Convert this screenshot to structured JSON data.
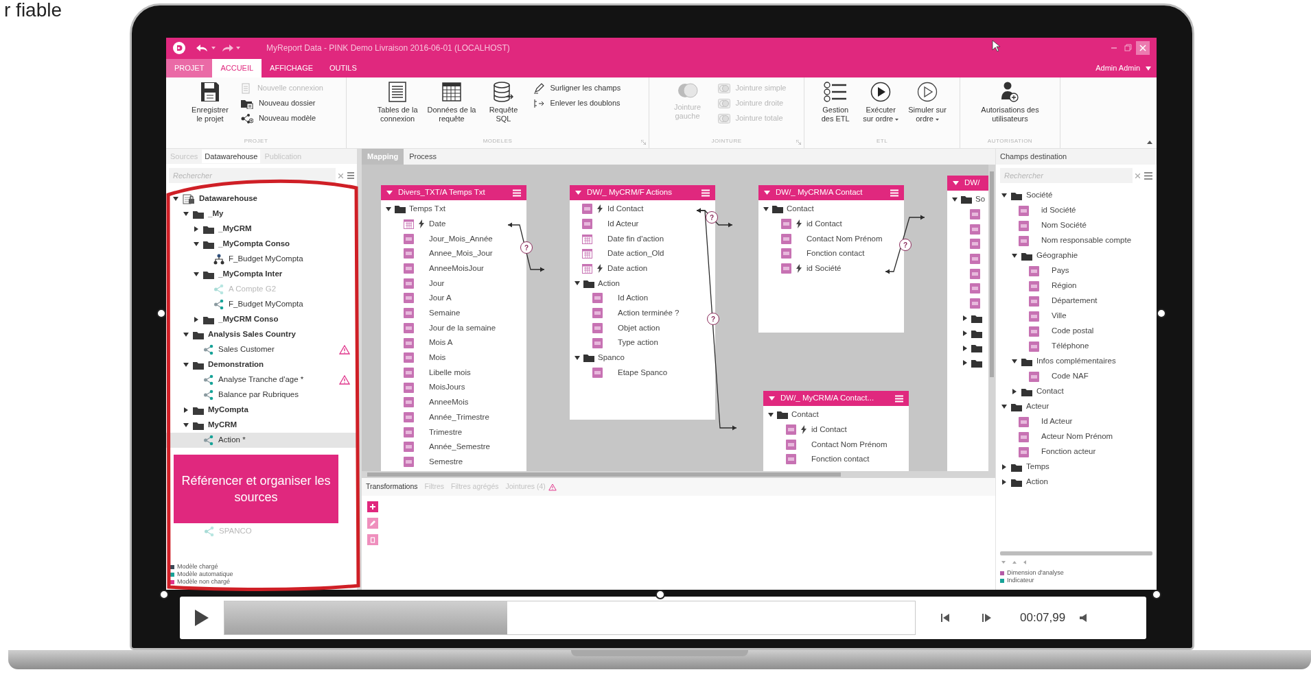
{
  "corner_text": "r fiable",
  "window": {
    "title": "MyReport Data - PINK Demo Livraison 2016-06-01 (LOCALHOST)",
    "user": "Admin Admin"
  },
  "tabs": [
    {
      "label": "PROJET",
      "kind": "file",
      "selected": false
    },
    {
      "label": "ACCUEIL",
      "kind": "tab",
      "selected": true
    },
    {
      "label": "AFFICHAGE",
      "kind": "tab",
      "selected": false
    },
    {
      "label": "OUTILS",
      "kind": "tab",
      "selected": false
    }
  ],
  "ribbon": {
    "groups": [
      {
        "label": "PROJET",
        "launcher": false,
        "large": [
          {
            "lines": [
              "Enregistrer",
              "le projet"
            ],
            "kind": "save",
            "disabled": false,
            "dropdown": false
          }
        ],
        "small": [
          {
            "label": "Nouvelle connexion",
            "kind": "connection",
            "disabled": true
          },
          {
            "label": "Nouveau dossier",
            "kind": "folder",
            "disabled": false
          },
          {
            "label": "Nouveau modèle",
            "kind": "model",
            "disabled": false
          }
        ]
      },
      {
        "label": "MODELES",
        "launcher": true,
        "large": [
          {
            "lines": [
              "Tables de la",
              "connexion"
            ],
            "kind": "list",
            "disabled": false,
            "dropdown": false
          },
          {
            "lines": [
              "Données de la",
              "requête"
            ],
            "kind": "grid",
            "disabled": false,
            "dropdown": false
          },
          {
            "lines": [
              "Requête",
              "SQL"
            ],
            "kind": "database",
            "disabled": false,
            "dropdown": false
          }
        ],
        "small": [
          {
            "label": "Surligner les champs",
            "kind": "pen",
            "disabled": false
          },
          {
            "label": "Enlever les doublons",
            "kind": "dedupe",
            "disabled": false
          }
        ]
      },
      {
        "label": "JOINTURE",
        "launcher": true,
        "large": [
          {
            "lines": [
              "Jointure",
              "gauche"
            ],
            "kind": "venn",
            "disabled": true,
            "dropdown": false
          }
        ],
        "small": [
          {
            "label": "Jointure simple",
            "kind": "join",
            "disabled": true
          },
          {
            "label": "Jointure droite",
            "kind": "join",
            "disabled": true
          },
          {
            "label": "Jointure totale",
            "kind": "join",
            "disabled": true
          }
        ]
      },
      {
        "label": "ETL",
        "launcher": false,
        "large": [
          {
            "lines": [
              "Gestion",
              "des ETL"
            ],
            "kind": "checklist",
            "disabled": false,
            "dropdown": false
          },
          {
            "lines": [
              "Exécuter",
              "sur ordre"
            ],
            "kind": "play",
            "disabled": false,
            "dropdown": true
          },
          {
            "lines": [
              "Simuler sur",
              "ordre"
            ],
            "kind": "play-outline",
            "disabled": false,
            "dropdown": true
          }
        ]
      },
      {
        "label": "AUTORISATION",
        "launcher": false,
        "large": [
          {
            "lines": [
              "Autorisations des",
              "utilisateurs"
            ],
            "kind": "user-add",
            "disabled": false,
            "dropdown": false
          }
        ]
      }
    ]
  },
  "left_panel": {
    "tabs": [
      {
        "label": "Sources",
        "selected": false
      },
      {
        "label": "Datawarehouse",
        "selected": true
      },
      {
        "label": "Publication",
        "selected": false
      }
    ],
    "search": {
      "placeholder": "Rechercher"
    },
    "tree": [
      {
        "label": "Datawarehouse",
        "kind": "warehouse",
        "expanded": true,
        "selected": false,
        "children": [
          {
            "label": "_My",
            "kind": "folder",
            "expanded": true,
            "selected": false,
            "children": [
              {
                "label": "_MyCRM",
                "kind": "folder",
                "expanded": false,
                "selected": false
              },
              {
                "label": "_MyCompta Conso",
                "kind": "folder",
                "expanded": true,
                "selected": false,
                "children": [
                  {
                    "label": "F_Budget MyCompta",
                    "kind": "hierarchy",
                    "dimmed": false,
                    "warning": false,
                    "selected": false
                  }
                ]
              },
              {
                "label": "_MyCompta Inter",
                "kind": "folder",
                "expanded": true,
                "selected": false,
                "children": [
                  {
                    "label": "A Compte G2",
                    "kind": "model",
                    "dimmed": true,
                    "warning": false,
                    "selected": false
                  },
                  {
                    "label": "F_Budget MyCompta",
                    "kind": "model",
                    "dimmed": false,
                    "warning": false,
                    "selected": false
                  }
                ]
              },
              {
                "label": "_MyCRM Conso",
                "kind": "folder",
                "expanded": false,
                "selected": false
              }
            ]
          },
          {
            "label": "Analysis Sales Country",
            "kind": "folder",
            "expanded": true,
            "selected": false,
            "children": [
              {
                "label": "Sales Customer",
                "kind": "model",
                "dimmed": false,
                "warning": true,
                "selected": false
              }
            ]
          },
          {
            "label": "Demonstration",
            "kind": "folder",
            "expanded": true,
            "selected": false,
            "children": [
              {
                "label": "Analyse Tranche d'age *",
                "kind": "model",
                "dimmed": false,
                "warning": true,
                "selected": false
              },
              {
                "label": "Balance par Rubriques",
                "kind": "model",
                "dimmed": false,
                "warning": false,
                "selected": false
              }
            ]
          },
          {
            "label": "MyCompta",
            "kind": "folder",
            "expanded": false,
            "selected": false
          },
          {
            "label": "MyCRM",
            "kind": "folder",
            "expanded": true,
            "selected": false,
            "children": [
              {
                "label": "Action *",
                "kind": "model",
                "dimmed": false,
                "warning": false,
                "selected": true
              }
            ]
          }
        ]
      }
    ],
    "callout": "Référencer et organiser les sources",
    "tree_below_callout": [
      {
        "label": "SPANCO",
        "kind": "model",
        "dimmed": true,
        "warning": false,
        "selected": false
      }
    ],
    "legend": [
      {
        "label": "Modèle chargé",
        "color": "#3a4a57"
      },
      {
        "label": "Modèle automatique",
        "color": "#17a398"
      },
      {
        "label": "Modèle non chargé",
        "color": "#e0338a"
      }
    ]
  },
  "center": {
    "tabs": [
      {
        "label": "Mapping",
        "selected": true
      },
      {
        "label": "Process",
        "selected": false
      }
    ],
    "cards": [
      {
        "title": "Divers_TXT/A Temps Txt",
        "items": [
          {
            "kind": "folder",
            "label": "Temps Txt",
            "expanded": true,
            "children": [
              {
                "kind": "date",
                "label": "Date",
                "key": true
              },
              {
                "kind": "text",
                "label": "Jour_Mois_Année",
                "key": false
              },
              {
                "kind": "text",
                "label": "Annee_Mois_Jour",
                "key": false
              },
              {
                "kind": "text",
                "label": "AnneeMoisJour",
                "key": false
              },
              {
                "kind": "text",
                "label": "Jour",
                "key": false
              },
              {
                "kind": "text",
                "label": "Jour A",
                "key": false
              },
              {
                "kind": "text",
                "label": "Semaine",
                "key": false
              },
              {
                "kind": "text",
                "label": "Jour de la semaine",
                "key": false
              },
              {
                "kind": "text",
                "label": "Mois A",
                "key": false
              },
              {
                "kind": "text",
                "label": "Mois",
                "key": false
              },
              {
                "kind": "text",
                "label": "Libelle mois",
                "key": false
              },
              {
                "kind": "text",
                "label": "MoisJours",
                "key": false
              },
              {
                "kind": "text",
                "label": "AnneeMois",
                "key": false
              },
              {
                "kind": "text",
                "label": "Année_Trimestre",
                "key": false
              },
              {
                "kind": "text",
                "label": "Trimestre",
                "key": false
              },
              {
                "kind": "text",
                "label": "Année_Semestre",
                "key": false
              },
              {
                "kind": "text",
                "label": "Semestre",
                "key": false
              }
            ]
          }
        ]
      },
      {
        "title": "DW/_ MyCRM/F Actions",
        "items": [
          {
            "kind": "text",
            "label": "Id Contact",
            "key": true
          },
          {
            "kind": "text",
            "label": "Id Acteur",
            "key": false
          },
          {
            "kind": "date",
            "label": "Date fin d'action",
            "key": false
          },
          {
            "kind": "date",
            "label": "Date action_Old",
            "key": false
          },
          {
            "kind": "date",
            "label": "Date action",
            "key": true
          },
          {
            "kind": "folder",
            "label": "Action",
            "expanded": true,
            "children": [
              {
                "kind": "text",
                "label": "Id Action",
                "key": false
              },
              {
                "kind": "text",
                "label": "Action terminée ?",
                "key": false
              },
              {
                "kind": "text",
                "label": "Objet action",
                "key": false
              },
              {
                "kind": "text",
                "label": "Type action",
                "key": false
              }
            ]
          },
          {
            "kind": "folder",
            "label": "Spanco",
            "expanded": true,
            "children": [
              {
                "kind": "text",
                "label": "Etape Spanco",
                "key": false
              }
            ]
          }
        ]
      },
      {
        "title": "DW/_ MyCRM/A Contact",
        "items": [
          {
            "kind": "folder",
            "label": "Contact",
            "expanded": true,
            "children": [
              {
                "kind": "text",
                "label": "id Contact",
                "key": true
              },
              {
                "kind": "text",
                "label": "Contact Nom Prénom",
                "key": false
              },
              {
                "kind": "text",
                "label": "Fonction contact",
                "key": false
              },
              {
                "kind": "text",
                "label": "id Société",
                "key": true
              }
            ]
          }
        ]
      },
      {
        "title": "DW/_ MyCRM/A Contact...",
        "items": [
          {
            "kind": "folder",
            "label": "Contact",
            "expanded": true,
            "children": [
              {
                "kind": "text",
                "label": "id Contact",
                "key": true
              },
              {
                "kind": "text",
                "label": "Contact Nom Prénom",
                "key": false
              },
              {
                "kind": "text",
                "label": "Fonction contact",
                "key": false
              }
            ]
          }
        ]
      },
      {
        "title": "DW/",
        "items": [
          {
            "kind": "folder",
            "label": "So",
            "expanded": true,
            "children": [
              {
                "kind": "text",
                "key": false
              },
              {
                "kind": "text",
                "key": false
              },
              {
                "kind": "text",
                "key": false
              },
              {
                "kind": "text",
                "key": false
              },
              {
                "kind": "text",
                "key": false
              },
              {
                "kind": "text",
                "key": false
              },
              {
                "kind": "text",
                "key": false
              },
              {
                "kind": "folder",
                "expanded": false
              },
              {
                "kind": "folder",
                "expanded": false
              },
              {
                "kind": "folder",
                "expanded": false
              },
              {
                "kind": "folder",
                "expanded": false
              }
            ]
          }
        ]
      }
    ],
    "joins": [
      {
        "label": "?"
      },
      {
        "label": "?"
      },
      {
        "label": "?"
      },
      {
        "label": "?"
      }
    ],
    "bottom_tabs": [
      {
        "label": "Transformations",
        "selected": true,
        "warning": false
      },
      {
        "label": "Filtres",
        "selected": false,
        "warning": false
      },
      {
        "label": "Filtres agrégés",
        "selected": false,
        "warning": false
      },
      {
        "label": "Jointures (4)",
        "selected": false,
        "warning": true
      }
    ]
  },
  "right_panel": {
    "title": "Champs destination",
    "search": {
      "placeholder": "Rechercher"
    },
    "tree": [
      {
        "kind": "folder",
        "label": "Société",
        "expanded": true,
        "children": [
          {
            "kind": "text",
            "label": "id Société"
          },
          {
            "kind": "text",
            "label": "Nom Société"
          },
          {
            "kind": "text",
            "label": "Nom responsable compte"
          },
          {
            "kind": "folder",
            "label": "Géographie",
            "expanded": true,
            "children": [
              {
                "kind": "text",
                "label": "Pays"
              },
              {
                "kind": "text",
                "label": "Région"
              },
              {
                "kind": "text",
                "label": "Département"
              },
              {
                "kind": "text",
                "label": "Ville"
              },
              {
                "kind": "text",
                "label": "Code postal"
              },
              {
                "kind": "text",
                "label": "Téléphone"
              }
            ]
          },
          {
            "kind": "folder",
            "label": "Infos complémentaires",
            "expanded": true,
            "children": [
              {
                "kind": "text",
                "label": "Code NAF"
              }
            ]
          },
          {
            "kind": "folder",
            "label": "Contact",
            "expanded": false
          }
        ]
      },
      {
        "kind": "folder",
        "label": "Acteur",
        "expanded": true,
        "children": [
          {
            "kind": "text",
            "label": "Id Acteur"
          },
          {
            "kind": "text",
            "label": "Acteur Nom Prénom"
          },
          {
            "kind": "text",
            "label": "Fonction acteur"
          }
        ]
      },
      {
        "kind": "folder",
        "label": "Temps",
        "expanded": false
      },
      {
        "kind": "folder",
        "label": "Action",
        "expanded": false
      }
    ],
    "legend": [
      {
        "label": "Dimension d'analyse",
        "color": "#b45aa6"
      },
      {
        "label": "Indicateur",
        "color": "#17a398"
      }
    ]
  },
  "player": {
    "level": 0.41,
    "time": "00:07,99"
  }
}
